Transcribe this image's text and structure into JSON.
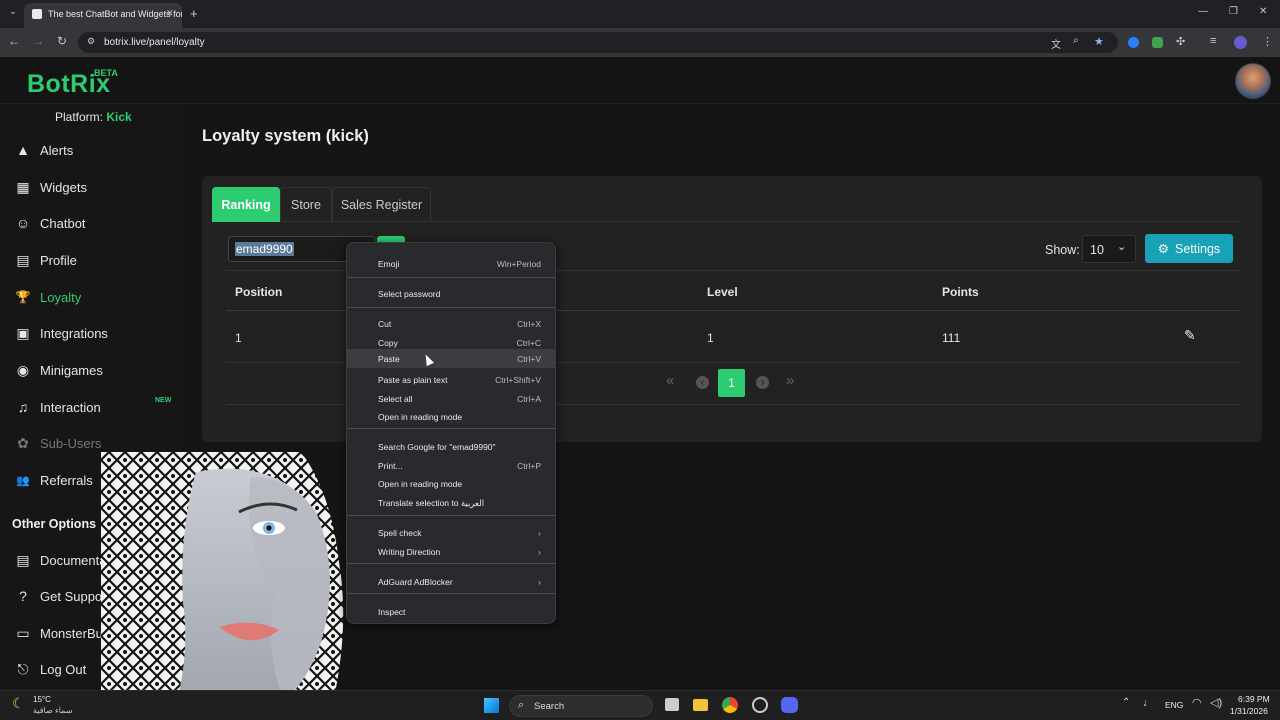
{
  "browser": {
    "tab_title": "The best ChatBot and Widgets for",
    "new_tab": "+",
    "url": "botrix.live/panel/loyalty",
    "window_controls": {
      "minimize": "—",
      "restore": "❐",
      "close": "✕"
    },
    "nav": {
      "back": "←",
      "forward": "→",
      "reload": "↻"
    }
  },
  "app": {
    "logo": "BotRix",
    "badge": "BETA",
    "platform_label": "Platform:",
    "platform_value": "Kick"
  },
  "sidebar": {
    "items": [
      {
        "label": "Alerts",
        "icon": "▲"
      },
      {
        "label": "Widgets",
        "icon": "▦"
      },
      {
        "label": "Chatbot",
        "icon": "☺"
      },
      {
        "label": "Profile",
        "icon": "▤"
      },
      {
        "label": "Loyalty",
        "icon": "🏆"
      },
      {
        "label": "Integrations",
        "icon": "▣"
      },
      {
        "label": "Minigames",
        "icon": "◉"
      },
      {
        "label": "Interaction",
        "icon": "♫",
        "badge": "NEW"
      },
      {
        "label": "Sub-Users",
        "icon": "✿"
      },
      {
        "label": "Referrals",
        "icon": "👥"
      }
    ],
    "other_title": "Other Options",
    "other": [
      {
        "label": "Documentation",
        "icon": "▤"
      },
      {
        "label": "Get Support",
        "icon": "?"
      },
      {
        "label": "MonsterBus",
        "icon": "▭"
      },
      {
        "label": "Log Out",
        "icon": "⎋"
      }
    ]
  },
  "page": {
    "title": "Loyalty system (kick)"
  },
  "tabs": [
    {
      "label": "Ranking"
    },
    {
      "label": "Store"
    },
    {
      "label": "Sales Register"
    }
  ],
  "search": {
    "value": "emad9990"
  },
  "show": {
    "label": "Show:",
    "value": "10"
  },
  "settings_button": "Settings",
  "table": {
    "headers": [
      "Position",
      "Level",
      "Points"
    ],
    "rows": [
      {
        "position": "1",
        "level": "1",
        "points": "111"
      }
    ]
  },
  "pagination": {
    "first": "«",
    "prev": "‹",
    "current": "1",
    "next": "›",
    "last": "»"
  },
  "context_menu": [
    {
      "label": "Emoji",
      "shortcut": "Win+Period"
    },
    {
      "label": "Select password",
      "shortcut": ""
    },
    {
      "label": "Cut",
      "shortcut": "Ctrl+X"
    },
    {
      "label": "Copy",
      "shortcut": "Ctrl+C"
    },
    {
      "label": "Paste",
      "shortcut": "Ctrl+V"
    },
    {
      "label": "Paste as plain text",
      "shortcut": "Ctrl+Shift+V"
    },
    {
      "label": "Select all",
      "shortcut": "Ctrl+A"
    },
    {
      "label": "Open in reading mode",
      "shortcut": ""
    },
    {
      "label": "Search Google for \"emad9990\"",
      "shortcut": ""
    },
    {
      "label": "Print...",
      "shortcut": "Ctrl+P"
    },
    {
      "label": "Open in reading mode",
      "shortcut": ""
    },
    {
      "label": "Translate selection to العربية",
      "shortcut": ""
    },
    {
      "label": "Spell check",
      "shortcut": "›"
    },
    {
      "label": "Writing Direction",
      "shortcut": "›"
    },
    {
      "label": "AdGuard AdBlocker",
      "shortcut": "›"
    },
    {
      "label": "Inspect",
      "shortcut": ""
    }
  ],
  "taskbar": {
    "weather_temp": "15°C",
    "weather_desc": "سماء صافية",
    "search": "Search",
    "lang": "ENG",
    "time": "6:39 PM",
    "date": "1/31/2026"
  },
  "colors": {
    "accent": "#2ecc71",
    "settings": "#17a2b8"
  }
}
